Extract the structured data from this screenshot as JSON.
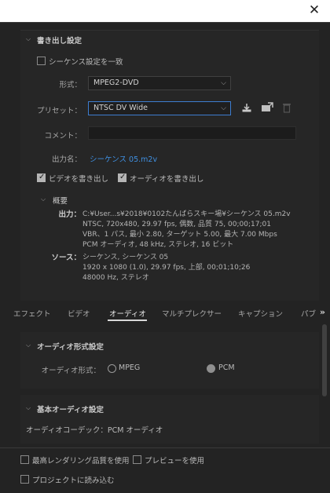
{
  "window": {
    "close_glyph": "✕"
  },
  "export_settings": {
    "header": "書き出し設定",
    "match_sequence_label": "シーケンス設定を一致",
    "format_label": "形式：",
    "format_value": "MPEG2-DVD",
    "preset_label": "プリセット：",
    "preset_value": "NTSC DV Wide",
    "comment_label": "コメント：",
    "output_name_label": "出力名：",
    "output_name_value": "シーケンス 05.m2v",
    "export_video_label": "ビデオを書き出し",
    "export_audio_label": "オーディオを書き出し",
    "summary_header": "概要",
    "output_label": "出力：",
    "output_lines": [
      "C:¥User...s¥2018¥0102たんばらスキー場¥シーケンス 05.m2v",
      "NTSC, 720x480, 29.97 fps, 偶数, 品質 75, 00;00;17;01",
      "VBR、1 パス, 最小 2.80, ターゲット 5.00, 最大 7.00 Mbps",
      "PCM オーディオ, 48 kHz, ステレオ, 16 ビット"
    ],
    "source_label": "ソース：",
    "source_lines": [
      "シーケンス, シーケンス 05",
      "1920 x 1080 (1.0), 29.97 fps, 上部, 00;01;10;26",
      "48000 Hz, ステレオ"
    ]
  },
  "tabs": [
    {
      "label": "エフェクト"
    },
    {
      "label": "ビデオ"
    },
    {
      "label": "オーディオ"
    },
    {
      "label": "マルチプレクサー"
    },
    {
      "label": "キャプション"
    },
    {
      "label": "パブ"
    }
  ],
  "audio_format": {
    "header": "オーディオ形式設定",
    "label": "オーディオ形式：",
    "option_mpeg": "MPEG",
    "option_pcm": "PCM",
    "selected": "PCM"
  },
  "basic_audio": {
    "header": "基本オーディオ設定",
    "codec_text": "オーディオコーデック：PCM オーディオ"
  },
  "bottom": {
    "max_quality_label": "最高レンダリング品質を使用",
    "use_preview_label": "プレビューを使用",
    "import_project_label": "プロジェクトに読み込む"
  },
  "colors": {
    "accent": "#3f8fe0",
    "focus_border": "#3d7dd0",
    "bg": "#232323"
  },
  "icons": [
    "close-icon",
    "save-preset-icon",
    "import-preset-icon",
    "delete-preset-icon",
    "chevron-down-icon",
    "tab-more-icon"
  ]
}
